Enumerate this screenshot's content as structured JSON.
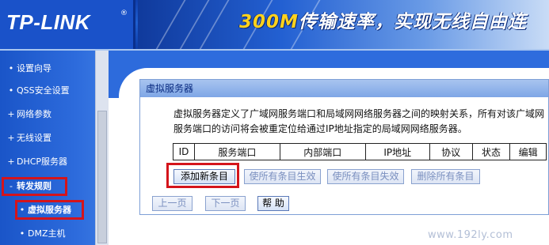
{
  "header": {
    "logo": "TP-LINK",
    "logo_mark": "®",
    "banner_speed": "300M",
    "banner_text": "传输速率，实现无线自由连"
  },
  "sidebar": {
    "items": [
      {
        "label": "设置向导",
        "bullet": "•"
      },
      {
        "label": "QSS安全设置",
        "bullet": "•"
      },
      {
        "label": "网络参数",
        "bullet": "+"
      },
      {
        "label": "无线设置",
        "bullet": "+"
      },
      {
        "label": "DHCP服务器",
        "bullet": "+"
      },
      {
        "label": "转发规则",
        "bullet": "-"
      },
      {
        "label": "虚拟服务器",
        "bullet": "•"
      },
      {
        "label": "DMZ主机",
        "bullet": "•"
      }
    ]
  },
  "panel": {
    "title": "虚拟服务器",
    "description": "虚拟服务器定义了广域网服务端口和局域网网络服务器之间的映射关系，所有对该广域网服务端口的访问将会被重定位给通过IP地址指定的局域网网络服务器。",
    "table": {
      "headers": [
        "ID",
        "服务端口",
        "内部端口",
        "IP地址",
        "协议",
        "状态",
        "编辑"
      ],
      "rows": []
    },
    "buttons": {
      "add": "添加新条目",
      "enable_all": "使所有条目生效",
      "disable_all": "使所有条目失效",
      "delete_all": "删除所有条目"
    }
  },
  "nav": {
    "prev": "上一页",
    "next": "下一页",
    "help": "帮 助"
  },
  "watermark": "www.192ly.com",
  "colors": {
    "highlight": "#d4141b",
    "sidebar": "#2d6bdc",
    "panel_title": "#7ea6e6"
  }
}
